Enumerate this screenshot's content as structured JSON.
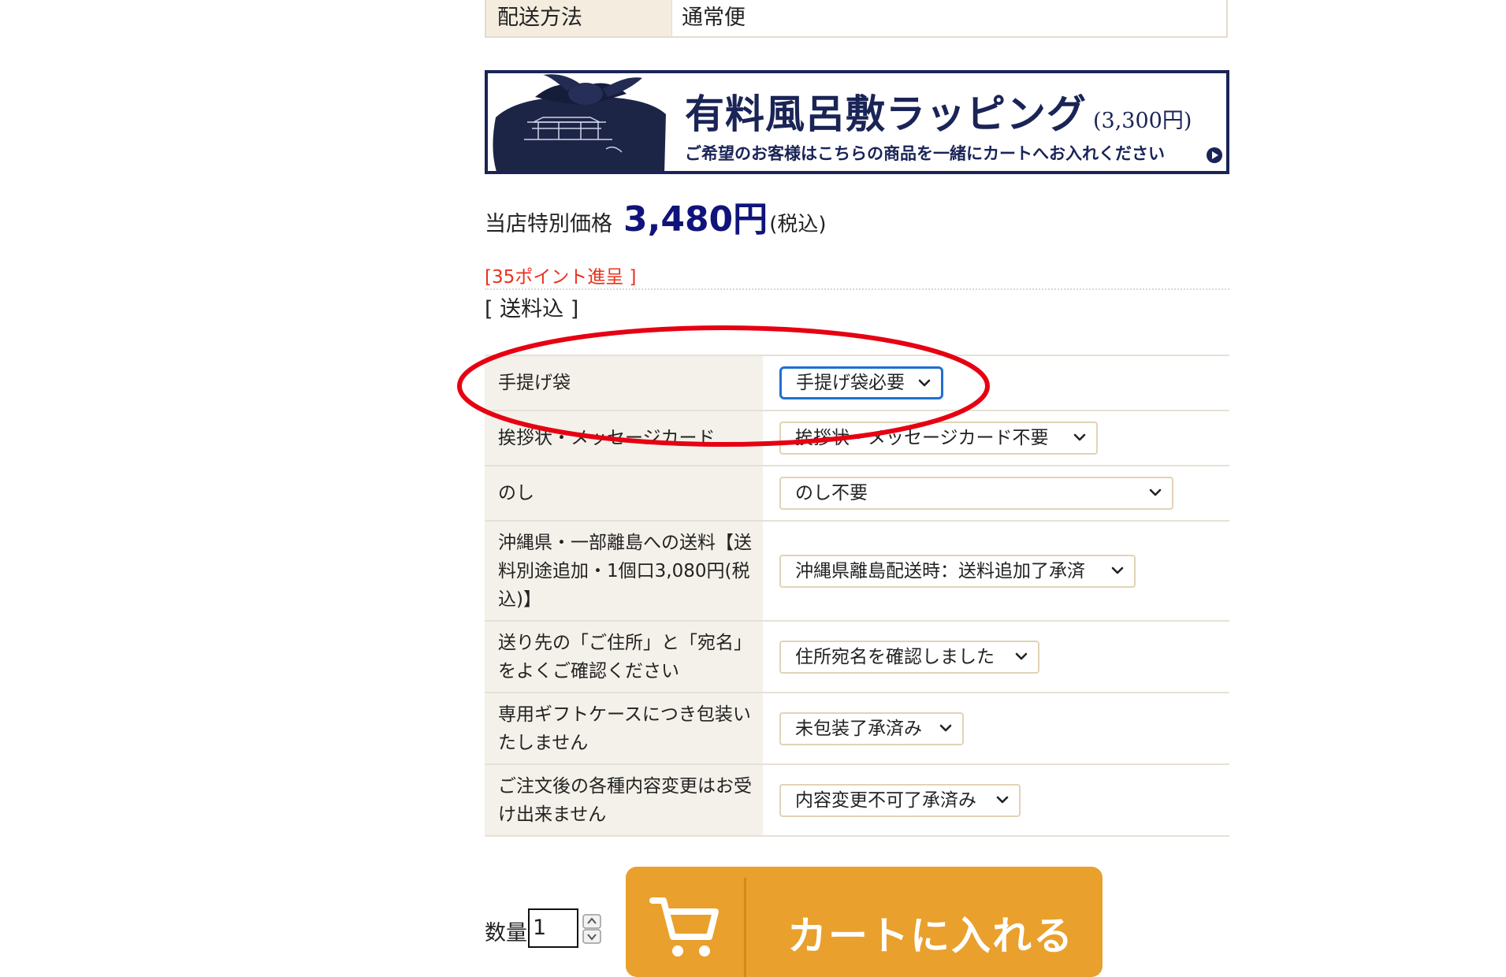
{
  "shipping": {
    "label": "配送方法",
    "value": "通常便"
  },
  "wrapping_banner": {
    "title": "有料風呂敷ラッピング",
    "price": "(3,300円)",
    "subtitle": "ご希望のお客様はこちらの商品を一緒にカートへお入れください"
  },
  "price": {
    "label": "当店特別価格",
    "value": "3,480円",
    "tax": "(税込)"
  },
  "points": "[35ポイント進呈 ]",
  "shipping_included": "[ 送料込 ]",
  "options": [
    {
      "label": "手提げ袋",
      "value": "手提げ袋必要"
    },
    {
      "label": "挨拶状・メッセージカード",
      "value": "挨拶状・メッセージカード不要"
    },
    {
      "label": "のし",
      "value": "のし不要"
    },
    {
      "label": "沖縄県・一部離島への送料【送料別途追加・1個口3,080円(税込)】",
      "value": "沖縄県離島配送時：送料追加了承済"
    },
    {
      "label": "送り先の「ご住所」と「宛名」をよくご確認ください",
      "value": "住所宛名を確認しました"
    },
    {
      "label": "専用ギフトケースにつき包装いたしません",
      "value": "未包装了承済み"
    },
    {
      "label": "ご注文後の各種内容変更はお受け出来ません",
      "value": "内容変更不可了承済み"
    }
  ],
  "quantity": {
    "label": "数量",
    "value": "1"
  },
  "cart_button": "カートに入れる",
  "colors": {
    "price": "#10147a",
    "points": "#e8321e",
    "cart": "#e9a02c",
    "annotation": "#e60012",
    "banner": "#1a2456"
  }
}
